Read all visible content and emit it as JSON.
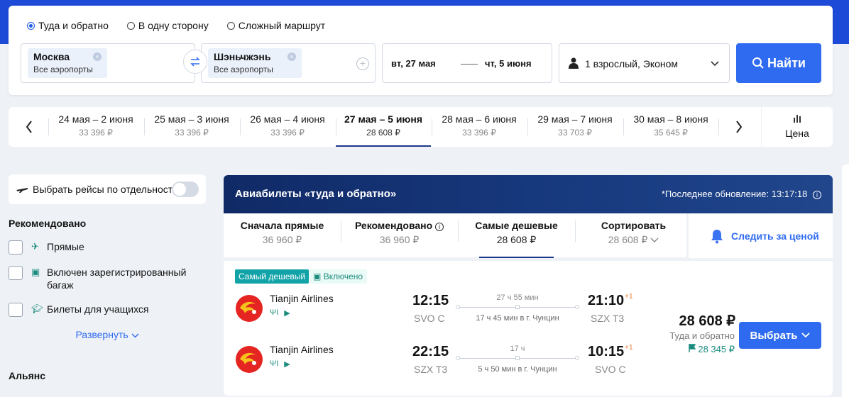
{
  "search": {
    "trip_types": [
      {
        "label": "Туда и обратно",
        "selected": true
      },
      {
        "label": "В одну сторону",
        "selected": false
      },
      {
        "label": "Сложный маршрут",
        "selected": false
      }
    ],
    "origin": {
      "city": "Москва",
      "sub": "Все аэропорты"
    },
    "destination": {
      "city": "Шэньчжэнь",
      "sub": "Все аэропорты"
    },
    "depart_date": "вт, 27 мая",
    "return_date": "чт, 5 июня",
    "passengers": "1 взрослый, Эконом",
    "find_label": "Найти"
  },
  "date_bar": {
    "items": [
      {
        "label": "24 мая – 2 июня",
        "price": "33 396 ₽"
      },
      {
        "label": "25 мая – 3 июня",
        "price": "33 396 ₽"
      },
      {
        "label": "26 мая – 4 июня",
        "price": "33 396 ₽"
      },
      {
        "label": "27 мая – 5 июня",
        "price": "28 608 ₽"
      },
      {
        "label": "28 мая – 6 июня",
        "price": "33 396 ₽"
      },
      {
        "label": "29 мая – 7 июня",
        "price": "33 703 ₽"
      },
      {
        "label": "30 мая – 8 июня",
        "price": "35 645 ₽"
      }
    ],
    "price_toggle_label": "Цена"
  },
  "sidebar": {
    "separate_flights_label": "Выбрать рейсы по отдельности",
    "recommended_title": "Рекомендовано",
    "filters": [
      {
        "label": "Прямые",
        "icon": "plane-icon"
      },
      {
        "label": "Включен зарегистрированный багаж",
        "icon": "luggage-icon"
      },
      {
        "label": "Билеты для учащихся",
        "icon": "graduation-cap-icon"
      }
    ],
    "expand_label": "Развернуть",
    "alliance_title": "Альянс"
  },
  "results": {
    "title": "Авиабилеты «туда и обратно»",
    "updated": "*Последнее обновление: 13:17:18",
    "sort_tabs": [
      {
        "title": "Сначала прямые",
        "price": "36 960 ₽"
      },
      {
        "title": "Рекомендовано",
        "price": "36 960 ₽"
      },
      {
        "title": "Самые дешевые",
        "price": "28 608 ₽"
      },
      {
        "title": "Сортировать",
        "price": "28 608 ₽"
      }
    ],
    "track_label": "Следить за ценой",
    "card": {
      "badge_cheapest": "Самый дешевый",
      "badge_baggage": "Включено",
      "segments": [
        {
          "airline": "Tianjin Airlines",
          "dep_time": "12:15",
          "dep_code": "SVO C",
          "duration": "27 ч 55 мин",
          "stop": "17 ч 45 мин в г. Чунцин",
          "arr_time": "21:10",
          "arr_plus": "+1",
          "arr_code": "SZX T3"
        },
        {
          "airline": "Tianjin Airlines",
          "dep_time": "22:15",
          "dep_code": "SZX T3",
          "duration": "17 ч",
          "stop": "5 ч 50 мин в г. Чунцин",
          "arr_time": "10:15",
          "arr_plus": "+1",
          "arr_code": "SVO C"
        }
      ],
      "price": "28 608 ₽",
      "price_note": "Туда и обратно",
      "price_alt": "28 345 ₽",
      "choose_label": "Выбрать"
    }
  },
  "colors": {
    "brand": "#1d4ad6",
    "button": "#2f6bf0",
    "accent_teal": "#12a3a8"
  }
}
